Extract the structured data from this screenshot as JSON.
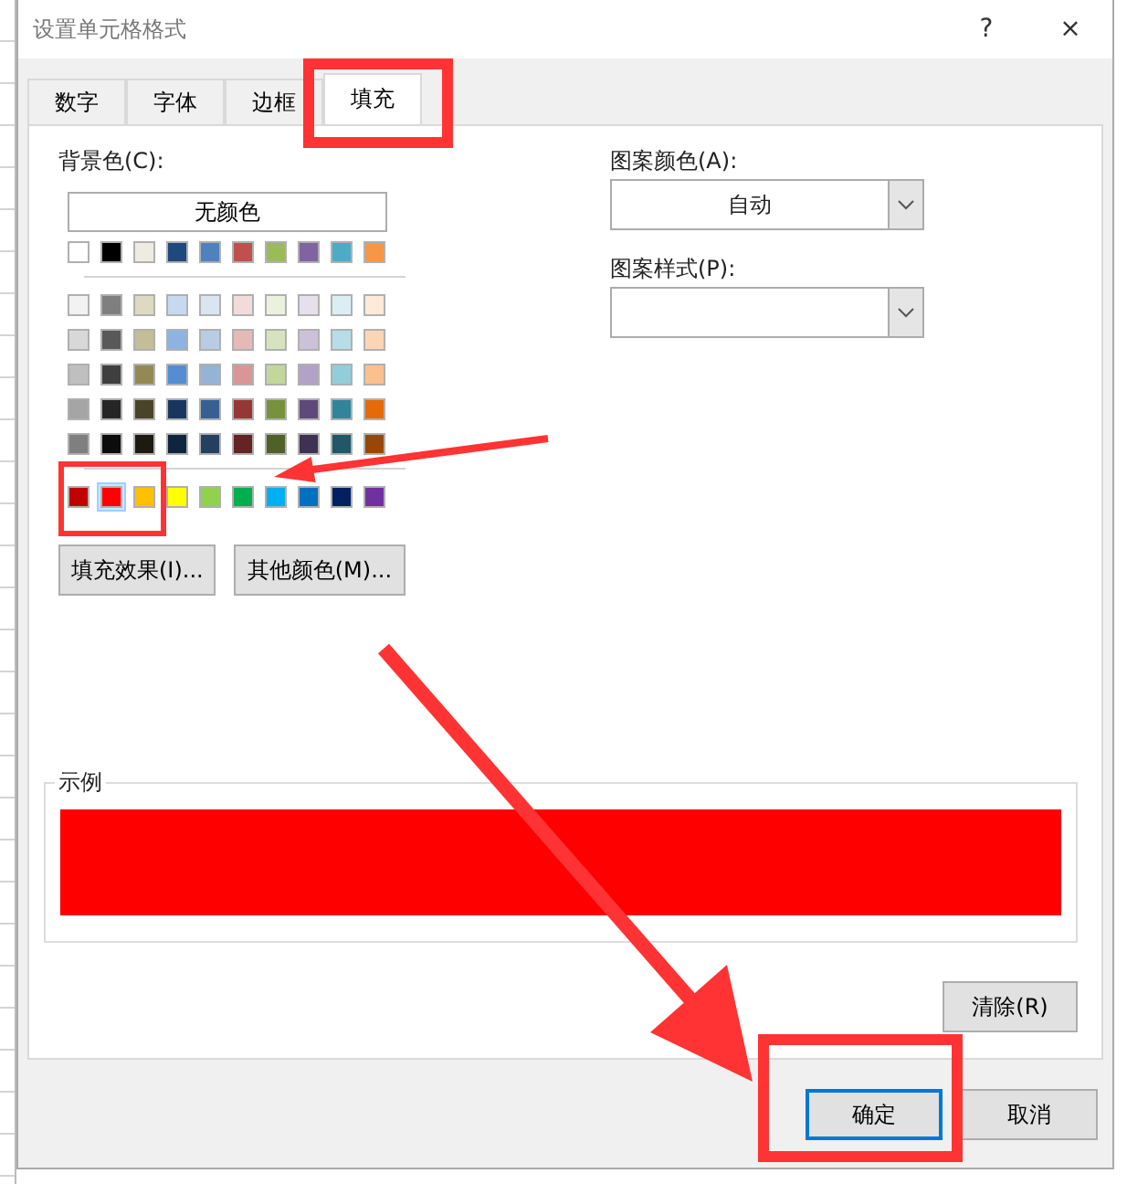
{
  "window": {
    "title": "设置单元格格式",
    "help": "?",
    "close": "×"
  },
  "tabs": [
    {
      "label": "数字",
      "selected": false
    },
    {
      "label": "字体",
      "selected": false
    },
    {
      "label": "边框",
      "selected": false
    },
    {
      "label": "填充",
      "selected": true
    }
  ],
  "background_color": {
    "label": "背景色(C):",
    "no_color_button": "无颜色",
    "theme_rows": [
      {
        "swatches": [
          {
            "color": "#ffffff",
            "selected": false
          },
          {
            "color": "#000000",
            "selected": false
          },
          {
            "color": "#eeece1",
            "selected": false
          },
          {
            "color": "#1f497d",
            "selected": false
          },
          {
            "color": "#4f81bd",
            "selected": false
          },
          {
            "color": "#c0504d",
            "selected": false
          },
          {
            "color": "#9bbb59",
            "selected": false
          },
          {
            "color": "#8064a2",
            "selected": false
          },
          {
            "color": "#4bacc6",
            "selected": false
          },
          {
            "color": "#f79646",
            "selected": false
          }
        ]
      },
      {
        "swatches": [
          {
            "color": "#f2f2f2",
            "selected": false
          },
          {
            "color": "#7f7f7f",
            "selected": false
          },
          {
            "color": "#ddd9c3",
            "selected": false
          },
          {
            "color": "#c6d9f0",
            "selected": false
          },
          {
            "color": "#dbe5f1",
            "selected": false
          },
          {
            "color": "#f2dcdb",
            "selected": false
          },
          {
            "color": "#ebf1dd",
            "selected": false
          },
          {
            "color": "#e5e0ec",
            "selected": false
          },
          {
            "color": "#dbeef3",
            "selected": false
          },
          {
            "color": "#fdeada",
            "selected": false
          }
        ]
      },
      {
        "swatches": [
          {
            "color": "#d8d8d8",
            "selected": false
          },
          {
            "color": "#595959",
            "selected": false
          },
          {
            "color": "#c4bd97",
            "selected": false
          },
          {
            "color": "#8db3e2",
            "selected": false
          },
          {
            "color": "#b8cce4",
            "selected": false
          },
          {
            "color": "#e5b9b7",
            "selected": false
          },
          {
            "color": "#d7e3bc",
            "selected": false
          },
          {
            "color": "#ccc1d9",
            "selected": false
          },
          {
            "color": "#b7dde8",
            "selected": false
          },
          {
            "color": "#fbd5b5",
            "selected": false
          }
        ]
      },
      {
        "swatches": [
          {
            "color": "#bfbfbf",
            "selected": false
          },
          {
            "color": "#3f3f3f",
            "selected": false
          },
          {
            "color": "#938953",
            "selected": false
          },
          {
            "color": "#548dd4",
            "selected": false
          },
          {
            "color": "#95b3d7",
            "selected": false
          },
          {
            "color": "#d99694",
            "selected": false
          },
          {
            "color": "#c3d69b",
            "selected": false
          },
          {
            "color": "#b2a2c7",
            "selected": false
          },
          {
            "color": "#92cddc",
            "selected": false
          },
          {
            "color": "#fac08f",
            "selected": false
          }
        ]
      },
      {
        "swatches": [
          {
            "color": "#a5a5a5",
            "selected": false
          },
          {
            "color": "#262626",
            "selected": false
          },
          {
            "color": "#494429",
            "selected": false
          },
          {
            "color": "#17365d",
            "selected": false
          },
          {
            "color": "#366092",
            "selected": false
          },
          {
            "color": "#953734",
            "selected": false
          },
          {
            "color": "#76923c",
            "selected": false
          },
          {
            "color": "#5f497a",
            "selected": false
          },
          {
            "color": "#31859b",
            "selected": false
          },
          {
            "color": "#e36c09",
            "selected": false
          }
        ]
      },
      {
        "swatches": [
          {
            "color": "#7f7f7f",
            "selected": false
          },
          {
            "color": "#0c0c0c",
            "selected": false
          },
          {
            "color": "#1d1b10",
            "selected": false
          },
          {
            "color": "#0f243e",
            "selected": false
          },
          {
            "color": "#244061",
            "selected": false
          },
          {
            "color": "#632423",
            "selected": false
          },
          {
            "color": "#4f6128",
            "selected": false
          },
          {
            "color": "#3f3151",
            "selected": false
          },
          {
            "color": "#205867",
            "selected": false
          },
          {
            "color": "#974806",
            "selected": false
          }
        ]
      }
    ],
    "standard_colors": [
      {
        "color": "#c00000",
        "selected": false
      },
      {
        "color": "#ff0000",
        "selected": true
      },
      {
        "color": "#ffc000",
        "selected": false
      },
      {
        "color": "#ffff00",
        "selected": false
      },
      {
        "color": "#92d050",
        "selected": false
      },
      {
        "color": "#00b050",
        "selected": false
      },
      {
        "color": "#00b0f0",
        "selected": false
      },
      {
        "color": "#0070c0",
        "selected": false
      },
      {
        "color": "#002060",
        "selected": false
      },
      {
        "color": "#7030a0",
        "selected": false
      }
    ],
    "fill_effects_button": "填充效果(I)...",
    "more_colors_button": "其他颜色(M)..."
  },
  "pattern": {
    "color_label": "图案颜色(A):",
    "color_value": "自动",
    "style_label": "图案样式(P):"
  },
  "sample": {
    "label": "示例",
    "color": "#ff0000"
  },
  "clear_button": "清除(R)",
  "buttons": [
    {
      "label": "确定",
      "default": true
    },
    {
      "label": "取消",
      "default": false
    }
  ]
}
